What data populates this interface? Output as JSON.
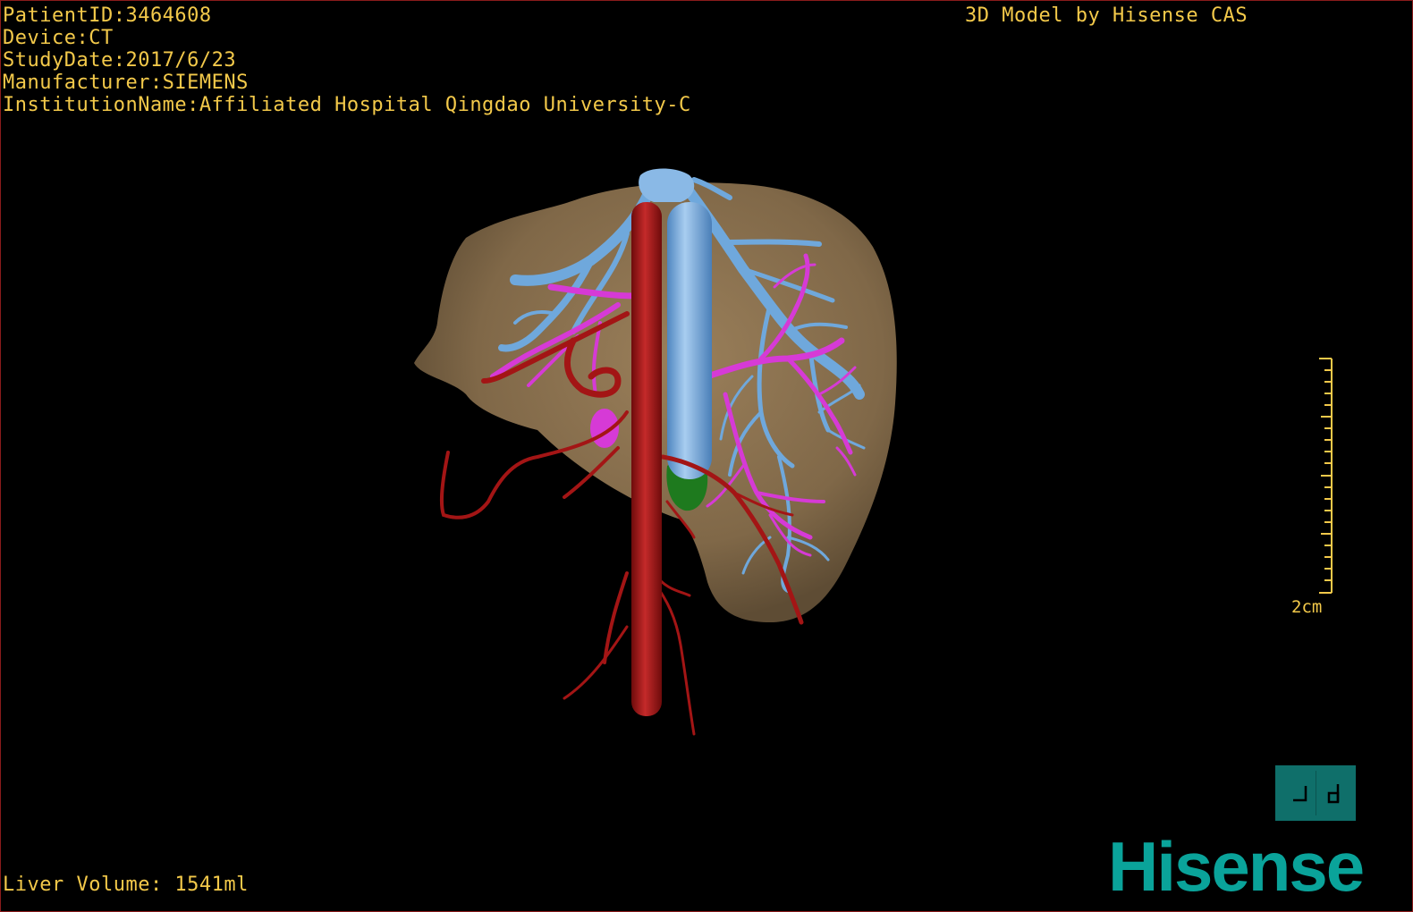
{
  "dicom": {
    "patient_id": "PatientID:3464608",
    "device": "Device:CT",
    "study_date": "StudyDate:2017/6/23",
    "manufacturer": "Manufacturer:SIEMENS",
    "institution": "InstitutionName:Affiliated Hospital Qingdao University-C"
  },
  "credit": "3D Model by Hisense CAS",
  "liver_volume": "Liver Volume: 1541ml",
  "scale_bar": {
    "label": "2cm"
  },
  "view_button": {
    "icon": "view-orientation-icon"
  },
  "brand": {
    "logo_text": "Hisense"
  },
  "colors": {
    "liver": "#8c7350",
    "portal_vein": "#6fa8dc",
    "artery": "#a31515",
    "hepatic_vein": "#d63ad6",
    "gallbladder": "#1e7a1e",
    "text": "#f3c94a",
    "brand": "#0aa39a"
  }
}
